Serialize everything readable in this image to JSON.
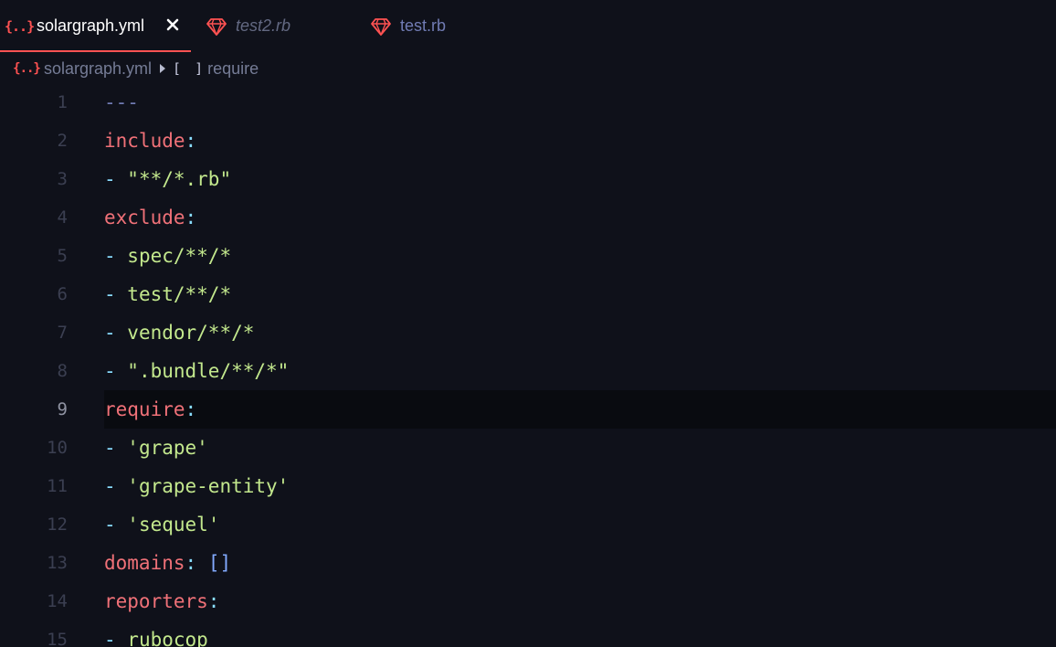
{
  "tabs": [
    {
      "label": "solargraph.yml",
      "icon": "yaml-braces-icon",
      "icon_text": "{..}",
      "active": true
    },
    {
      "label": "test2.rb",
      "icon": "ruby-gem-icon",
      "active": false,
      "italic": true
    },
    {
      "label": "test.rb",
      "icon": "ruby-gem-icon",
      "active": false
    }
  ],
  "breadcrumb": {
    "file_icon_text": "{..}",
    "file": "solargraph.yml",
    "array_icon_text": "[ ]",
    "symbol": "require"
  },
  "editor": {
    "current_line": 9,
    "lines": [
      {
        "n": "1",
        "key": "---",
        "rest": ""
      },
      {
        "n": "2",
        "key": "include",
        "colon": ":"
      },
      {
        "n": "3",
        "dash": "- ",
        "value": "\"**/*.rb\""
      },
      {
        "n": "4",
        "key": "exclude",
        "colon": ":"
      },
      {
        "n": "5",
        "dash": "- ",
        "value": "spec/**/*"
      },
      {
        "n": "6",
        "dash": "- ",
        "value": "test/**/*"
      },
      {
        "n": "7",
        "dash": "- ",
        "value": "vendor/**/*"
      },
      {
        "n": "8",
        "dash": "- ",
        "value": "\".bundle/**/*\""
      },
      {
        "n": "9",
        "key": "require",
        "colon": ":"
      },
      {
        "n": "10",
        "dash": "- ",
        "value": "'grape'"
      },
      {
        "n": "11",
        "dash": "- ",
        "value": "'grape-entity'"
      },
      {
        "n": "12",
        "dash": "- ",
        "value": "'sequel'"
      },
      {
        "n": "13",
        "key": "domains",
        "colon": ": ",
        "bracket": "[]"
      },
      {
        "n": "14",
        "key": "reporters",
        "colon": ":"
      },
      {
        "n": "15",
        "dash": "- ",
        "value": "rubocop"
      }
    ]
  },
  "colors": {
    "background": "#0f111a",
    "accent": "#ff5252",
    "key": "#f07178",
    "string": "#c3e88d",
    "punctuation": "#89ddff",
    "bracket": "#82aaff"
  }
}
